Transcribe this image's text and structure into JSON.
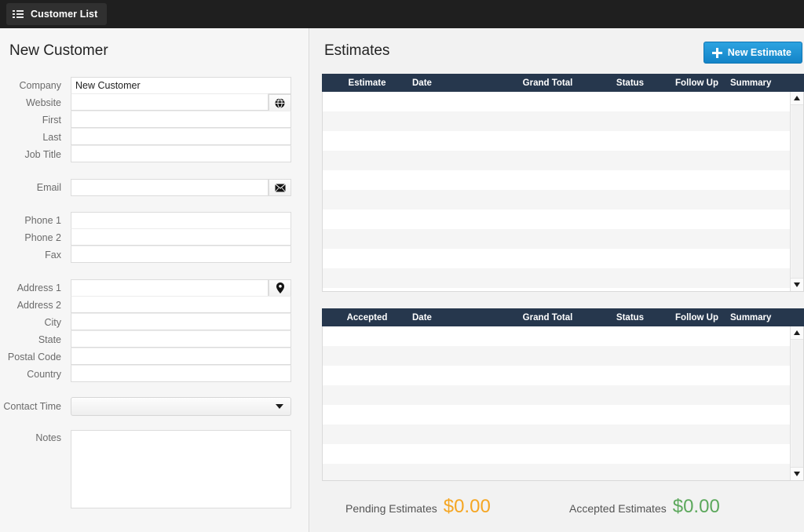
{
  "topbar": {
    "nav_button_label": "Customer List",
    "nav_icon": "list-icon",
    "background": "#1f1f1f"
  },
  "left": {
    "title": "New Customer",
    "groups": [
      {
        "fields": [
          {
            "label": "Company",
            "value": "New Customer",
            "placeholder": "",
            "icon": null
          },
          {
            "label": "Website",
            "value": "",
            "placeholder": "",
            "icon": "globe-icon"
          },
          {
            "label": "First",
            "value": "",
            "placeholder": "",
            "icon": null
          },
          {
            "label": "Last",
            "value": "",
            "placeholder": "",
            "icon": null
          },
          {
            "label": "Job Title",
            "value": "",
            "placeholder": "",
            "icon": null
          }
        ]
      },
      {
        "fields": [
          {
            "label": "Email",
            "value": "",
            "placeholder": "",
            "icon": "envelope-icon"
          }
        ]
      },
      {
        "fields": [
          {
            "label": "Phone 1",
            "value": "",
            "placeholder": "",
            "icon": null
          },
          {
            "label": "Phone 2",
            "value": "",
            "placeholder": "",
            "icon": null
          },
          {
            "label": "Fax",
            "value": "",
            "placeholder": "",
            "icon": null
          }
        ]
      },
      {
        "fields": [
          {
            "label": "Address 1",
            "value": "",
            "placeholder": "",
            "icon": "map-pin-icon"
          },
          {
            "label": "Address 2",
            "value": "",
            "placeholder": "",
            "icon": null
          },
          {
            "label": "City",
            "value": "",
            "placeholder": "",
            "icon": null
          },
          {
            "label": "State",
            "value": "",
            "placeholder": "",
            "icon": null
          },
          {
            "label": "Postal Code",
            "value": "",
            "placeholder": "",
            "icon": null
          },
          {
            "label": "Country",
            "value": "",
            "placeholder": "",
            "icon": null
          }
        ]
      }
    ],
    "contact_time": {
      "label": "Contact Time",
      "value": "",
      "icon": "chevron-down-icon"
    },
    "notes": {
      "label": "Notes",
      "value": "",
      "placeholder": ""
    }
  },
  "right": {
    "title": "Estimates",
    "new_estimate_button": {
      "label": "New Estimate",
      "icon": "plus-icon",
      "color": "#1484c8"
    },
    "grids": [
      {
        "name": "pending-estimates-grid",
        "columns": [
          "Estimate",
          "Date",
          "Grand Total",
          "Status",
          "Follow Up",
          "Summary"
        ],
        "rows": [],
        "visible_row_slots": 10
      },
      {
        "name": "accepted-estimates-grid",
        "columns": [
          "Accepted",
          "Date",
          "Grand Total",
          "Status",
          "Follow Up",
          "Summary"
        ],
        "rows": [],
        "visible_row_slots": 7
      }
    ],
    "totals": [
      {
        "label": "Pending Estimates",
        "value": "$0.00",
        "color": "#f5a623"
      },
      {
        "label": "Accepted Estimates",
        "value": "$0.00",
        "color": "#5ca85c"
      }
    ],
    "header_color": "#26374d"
  }
}
